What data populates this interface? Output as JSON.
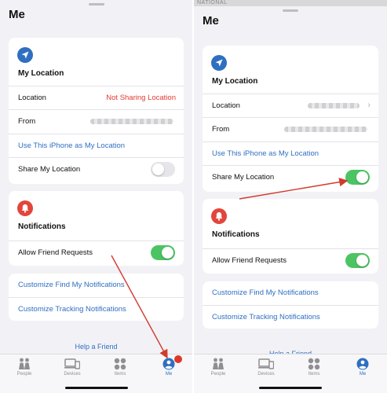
{
  "colors": {
    "accent": "#2f6fc1",
    "danger": "#e3392f",
    "toggle_on": "#4cc463",
    "arrow": "#d23a2e"
  },
  "left": {
    "title": "Me",
    "location_card": {
      "icon": "location-arrow-icon",
      "heading": "My Location",
      "rows": {
        "location_label": "Location",
        "location_value": "Not Sharing Location",
        "from_label": "From",
        "use_this_iphone": "Use This iPhone as My Location",
        "share_my_location": "Share My Location",
        "share_my_location_on": false
      }
    },
    "notifications_card": {
      "icon": "bell-icon",
      "heading": "Notifications",
      "allow_friend_requests": "Allow Friend Requests",
      "allow_friend_requests_on": true
    },
    "links_card": {
      "customize_find_my": "Customize Find My Notifications",
      "customize_tracking": "Customize Tracking Notifications"
    },
    "help": "Help a Friend"
  },
  "right": {
    "map_text": "NATIONAL",
    "title": "Me",
    "location_card": {
      "icon": "location-arrow-icon",
      "heading": "My Location",
      "rows": {
        "location_label": "Location",
        "from_label": "From",
        "use_this_iphone": "Use This iPhone as My Location",
        "share_my_location": "Share My Location",
        "share_my_location_on": true
      }
    },
    "notifications_card": {
      "icon": "bell-icon",
      "heading": "Notifications",
      "allow_friend_requests": "Allow Friend Requests",
      "allow_friend_requests_on": true
    },
    "links_card": {
      "customize_find_my": "Customize Find My Notifications",
      "customize_tracking": "Customize Tracking Notifications"
    },
    "help": "Help a Friend"
  },
  "tabbar": {
    "tabs": [
      {
        "label": "People",
        "icon": "people-icon"
      },
      {
        "label": "Devices",
        "icon": "devices-icon"
      },
      {
        "label": "Items",
        "icon": "items-icon"
      },
      {
        "label": "Me",
        "icon": "me-icon"
      }
    ],
    "active": "Me"
  }
}
